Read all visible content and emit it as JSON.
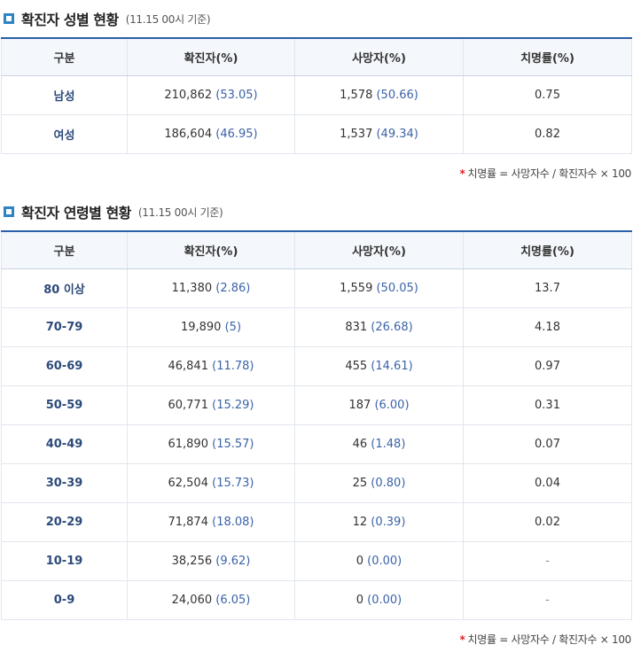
{
  "gender_section": {
    "title": "확진자 성별 현황",
    "subtitle": "(11.15 00시 기준)",
    "headers": [
      "구분",
      "확진자(%)",
      "사망자(%)",
      "치명률(%)"
    ],
    "rows": [
      {
        "label": "남성",
        "confirmed": "210,862",
        "confirmed_pct": "(53.05)",
        "deaths": "1,578",
        "deaths_pct": "(50.66)",
        "fatality": "0.75"
      },
      {
        "label": "여성",
        "confirmed": "186,604",
        "confirmed_pct": "(46.95)",
        "deaths": "1,537",
        "deaths_pct": "(49.34)",
        "fatality": "0.82"
      }
    ],
    "note_star": "*",
    "note": "치명률 = 사망자수 / 확진자수 × 100"
  },
  "age_section": {
    "title": "확진자 연령별 현황",
    "subtitle": "(11.15 00시 기준)",
    "headers": [
      "구분",
      "확진자(%)",
      "사망자(%)",
      "치명률(%)"
    ],
    "rows": [
      {
        "label": "80 이상",
        "confirmed": "11,380",
        "confirmed_pct": "(2.86)",
        "deaths": "1,559",
        "deaths_pct": "(50.05)",
        "fatality": "13.7"
      },
      {
        "label": "70-79",
        "confirmed": "19,890",
        "confirmed_pct": "(5)",
        "deaths": "831",
        "deaths_pct": "(26.68)",
        "fatality": "4.18"
      },
      {
        "label": "60-69",
        "confirmed": "46,841",
        "confirmed_pct": "(11.78)",
        "deaths": "455",
        "deaths_pct": "(14.61)",
        "fatality": "0.97"
      },
      {
        "label": "50-59",
        "confirmed": "60,771",
        "confirmed_pct": "(15.29)",
        "deaths": "187",
        "deaths_pct": "(6.00)",
        "fatality": "0.31"
      },
      {
        "label": "40-49",
        "confirmed": "61,890",
        "confirmed_pct": "(15.57)",
        "deaths": "46",
        "deaths_pct": "(1.48)",
        "fatality": "0.07"
      },
      {
        "label": "30-39",
        "confirmed": "62,504",
        "confirmed_pct": "(15.73)",
        "deaths": "25",
        "deaths_pct": "(0.80)",
        "fatality": "0.04"
      },
      {
        "label": "20-29",
        "confirmed": "71,874",
        "confirmed_pct": "(18.08)",
        "deaths": "12",
        "deaths_pct": "(0.39)",
        "fatality": "0.02"
      },
      {
        "label": "10-19",
        "confirmed": "38,256",
        "confirmed_pct": "(9.62)",
        "deaths": "0",
        "deaths_pct": "(0.00)",
        "fatality": "-"
      },
      {
        "label": "0-9",
        "confirmed": "24,060",
        "confirmed_pct": "(6.05)",
        "deaths": "0",
        "deaths_pct": "(0.00)",
        "fatality": "-"
      }
    ],
    "note_star": "*",
    "note": "치명률 = 사망자수 / 확진자수 × 100"
  },
  "colors": {
    "accent": "#2e83c4",
    "header_border": "#2a5fa9",
    "header_bg": "#f4f7fb",
    "value_blue": "#3b63a8",
    "star_red": "#d6242c"
  },
  "icons": {
    "section_marker": "square-outline-icon"
  }
}
